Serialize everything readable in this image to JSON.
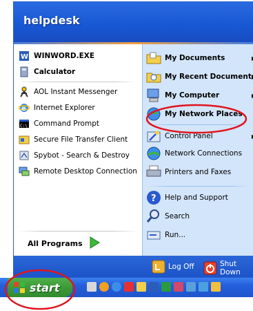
{
  "header": {
    "username": "helpdesk"
  },
  "left_items": [
    {
      "label": "WINWORD.EXE",
      "icon": "word-icon"
    },
    {
      "label": "Calculator",
      "icon": "calculator-icon"
    },
    {
      "label": "AOL Instant Messenger",
      "icon": "aim-icon"
    },
    {
      "label": "Internet Explorer",
      "icon": "internet-explorer-icon"
    },
    {
      "label": "Command Prompt",
      "icon": "command-prompt-icon"
    },
    {
      "label": "Secure File Transfer Client",
      "icon": "sftp-icon"
    },
    {
      "label": "Spybot - Search & Destroy",
      "icon": "spybot-icon"
    },
    {
      "label": "Remote Desktop Connection",
      "icon": "remote-desktop-icon"
    }
  ],
  "all_programs": {
    "label": "All Programs",
    "icon": "green-arrow-icon"
  },
  "right_items": [
    {
      "label": "My Documents",
      "icon": "folder-documents-icon",
      "submenu": true
    },
    {
      "label": "My Recent Documents",
      "icon": "folder-recent-icon",
      "submenu": true
    },
    {
      "label": "My Computer",
      "icon": "computer-icon",
      "submenu": true
    },
    {
      "label": "My Network Places",
      "icon": "network-places-icon",
      "submenu": false
    },
    {
      "label": "Control Panel",
      "icon": "control-panel-icon",
      "submenu": true
    },
    {
      "label": "Network Connections",
      "icon": "network-connections-icon",
      "submenu": false
    },
    {
      "label": "Printers and Faxes",
      "icon": "printer-icon",
      "submenu": false
    },
    {
      "label": "Help and Support",
      "icon": "help-icon",
      "submenu": false
    },
    {
      "label": "Search",
      "icon": "search-icon",
      "submenu": false
    },
    {
      "label": "Run...",
      "icon": "run-icon",
      "submenu": false
    }
  ],
  "footer": {
    "log_off": "Log Off",
    "shut_down": "Shut Down"
  },
  "taskbar": {
    "start_label": "start"
  },
  "colors": {
    "menu_blue": "#1757d3",
    "right_pane": "#d3e5fa",
    "start_green": "#3c9a37",
    "annotation_red": "#e0141e"
  }
}
